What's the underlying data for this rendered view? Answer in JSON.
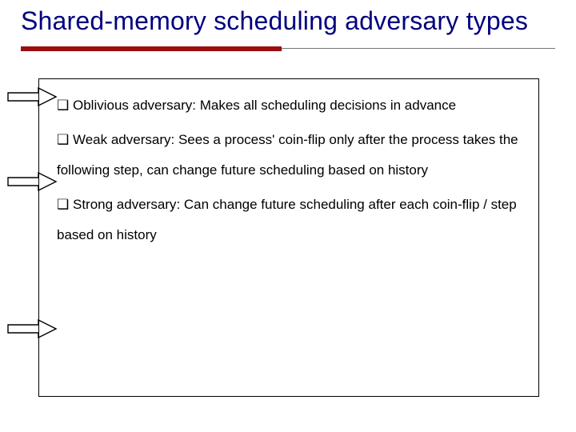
{
  "title": "Shared-memory scheduling adversary types",
  "bullet_glyph": "❑",
  "items": [
    {
      "term": "Oblivious adversary",
      "desc": ": Makes all scheduling decisions in advance"
    },
    {
      "term": "Weak adversary",
      "desc": ": Sees a process' coin-flip only after the process takes the following step, can change future scheduling based on history"
    },
    {
      "term": "Strong adversary",
      "desc": ": Can change future scheduling after each coin-flip / step based on history"
    }
  ]
}
